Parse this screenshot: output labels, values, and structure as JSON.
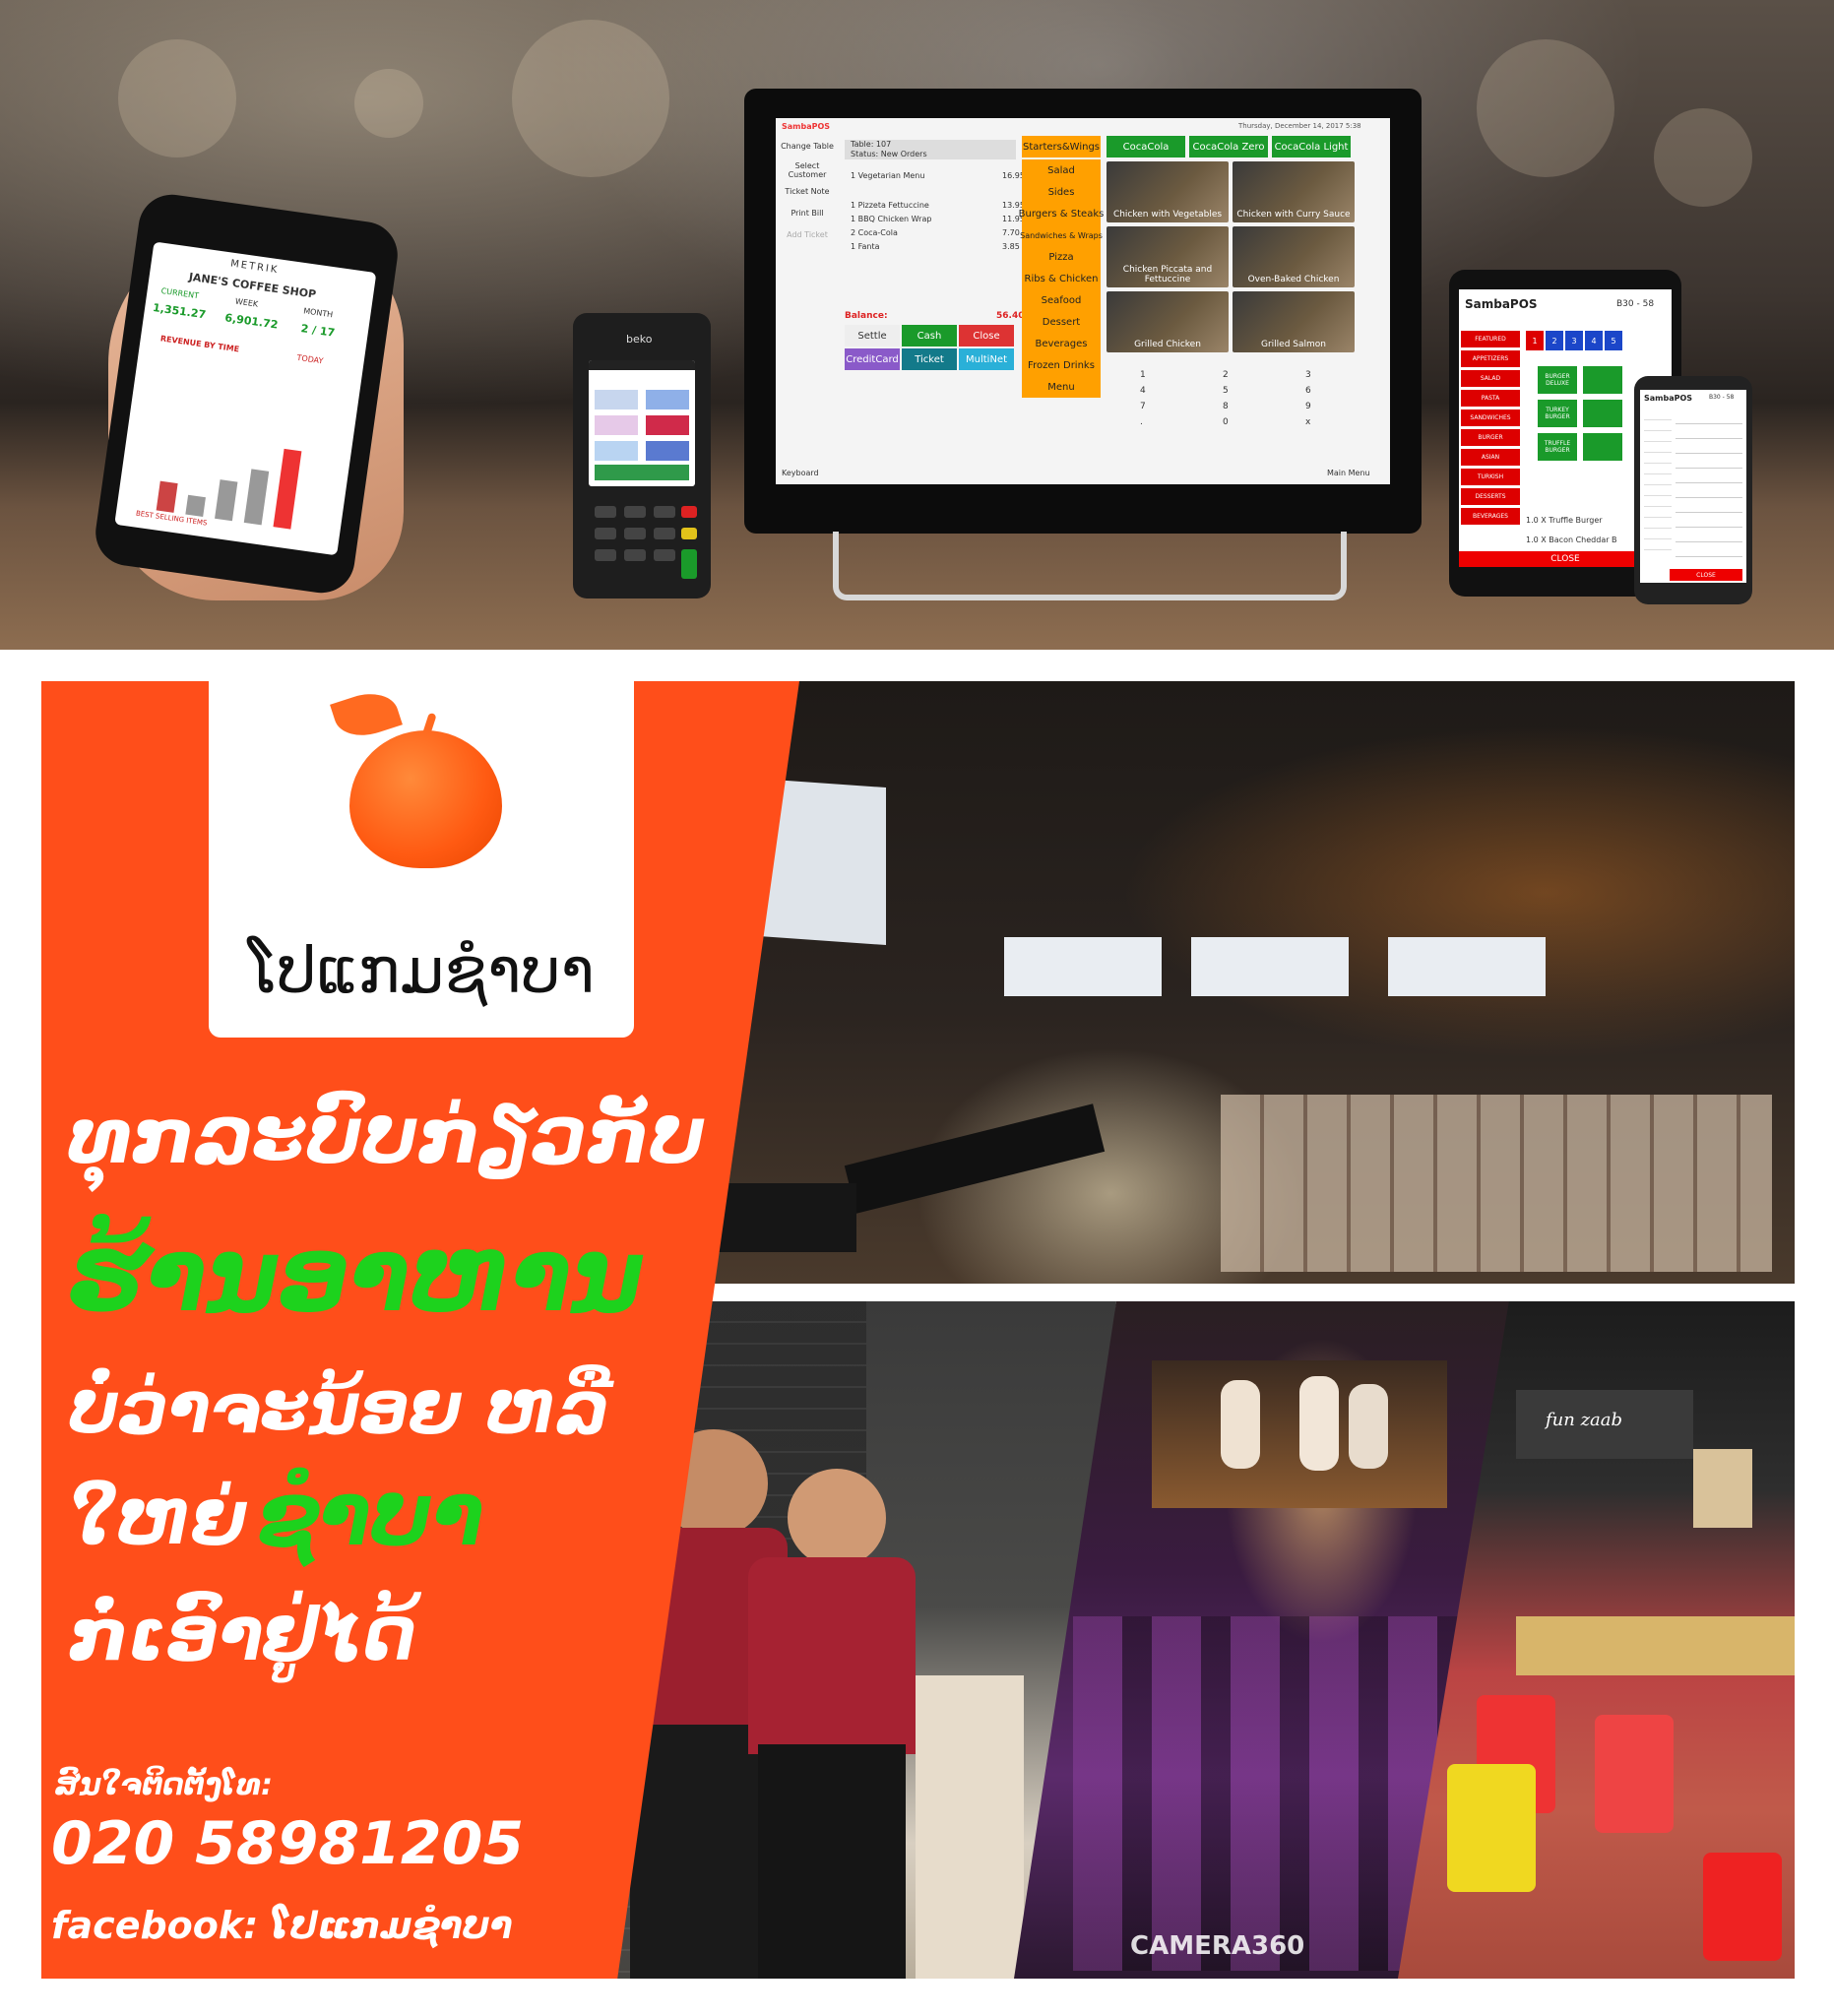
{
  "hero": {
    "phone_app": {
      "brand": "METRIK",
      "shop": "JANE'S COFFEE SHOP",
      "tabs": [
        "CURRENT",
        "WEEK",
        "MONTH"
      ],
      "stats": [
        "1,351.27",
        "6,901.72",
        "2 / 17"
      ],
      "section": "REVENUE BY TIME",
      "period": "TODAY",
      "bottom": "BEST SELLING ITEMS"
    },
    "terminal_brand": "beko",
    "pos": {
      "brand": "SambaPOS",
      "datetime": "Thursday, December 14, 2017 5:38",
      "table": "Table: 107",
      "status": "Status: New Orders",
      "side_buttons": [
        "Change Table",
        "Select Customer",
        "Ticket Note",
        "Print Bill",
        "Add Ticket"
      ],
      "orders": [
        {
          "item": "1 Vegetarian Menu",
          "price": "16.95"
        },
        {
          "item": "1 Pizzeta Fettuccine",
          "price": "13.95"
        },
        {
          "item": "1 BBQ Chicken Wrap",
          "price": "11.95"
        },
        {
          "item": "2 Coca-Cola",
          "price": "7.70"
        },
        {
          "item": "1 Fanta",
          "price": "3.85"
        }
      ],
      "balance_label": "Balance:",
      "balance_value": "56.40",
      "pay_buttons": [
        "Settle",
        "Cash",
        "Close",
        "CreditCard",
        "Ticket",
        "MultiNet"
      ],
      "categories": [
        "Starters&Wings",
        "Salad",
        "Sides",
        "Burgers & Steaks",
        "Sandwiches & Wraps",
        "Pizza",
        "Ribs & Chicken",
        "Seafood",
        "Dessert",
        "Beverages",
        "Frozen Drinks",
        "Menu"
      ],
      "drinks": [
        "CocaCola",
        "CocaCola Zero",
        "CocaCola Light"
      ],
      "foods": [
        "Chicken with Vegetables",
        "Chicken with Curry Sauce",
        "Chicken Piccata and Fettuccine",
        "Oven-Baked Chicken",
        "Grilled Chicken",
        "Grilled Salmon"
      ],
      "keypad": [
        "1",
        "2",
        "3",
        "4",
        "5",
        "6",
        "7",
        "8",
        "9",
        ".",
        "0",
        "x"
      ],
      "keyboard": "Keyboard",
      "main_menu": "Main Menu"
    },
    "tablet": {
      "brand": "SambaPOS",
      "table": "B30 - 58",
      "categories": [
        "FEATURED",
        "APPETIZERS",
        "SALAD",
        "PASTA",
        "SANDWICHES",
        "BURGER",
        "ASIAN",
        "TURKISH",
        "DESSERTS",
        "BEVERAGES"
      ],
      "numbers": [
        "1",
        "2",
        "3",
        "4",
        "5"
      ],
      "items": [
        "BURGER DELUXE",
        "TURKEY BURGER",
        "TRUFFLE BURGER"
      ],
      "order_lines": [
        "1.0 X Truffle Burger",
        "1.0 X Bacon Cheddar B"
      ],
      "close": "CLOSE"
    },
    "mini_phone": {
      "brand": "SambaPOS",
      "table": "B30 - 58",
      "close": "CLOSE"
    }
  },
  "brand_name": "ໂປແກມຊຳບາ",
  "headline": {
    "line1": "ທຸກລະບົບກ່ຽວກັບ",
    "line2": "ຮ້ານອາຫານ",
    "line3": "ບໍ່ວ່າຈະນ້ອຍ ຫລື",
    "line4_a": "ໃຫຍ່",
    "line4_b": "ຊຳບາ",
    "line5": "ກໍ່ເອົາຢູ່ໄດ້"
  },
  "contact": {
    "label": "ສົນໃຈຕິດຕັ້ງໂທ:",
    "phone": "020 58981205",
    "facebook": "facebook: ໂປແກມຊຳບາ"
  },
  "photos": {
    "watermark": "CAMERA360",
    "cafe_sign": "fun zaab"
  },
  "colors": {
    "orange": "#ff4e1a",
    "green": "#1dd21d",
    "white": "#ffffff"
  }
}
